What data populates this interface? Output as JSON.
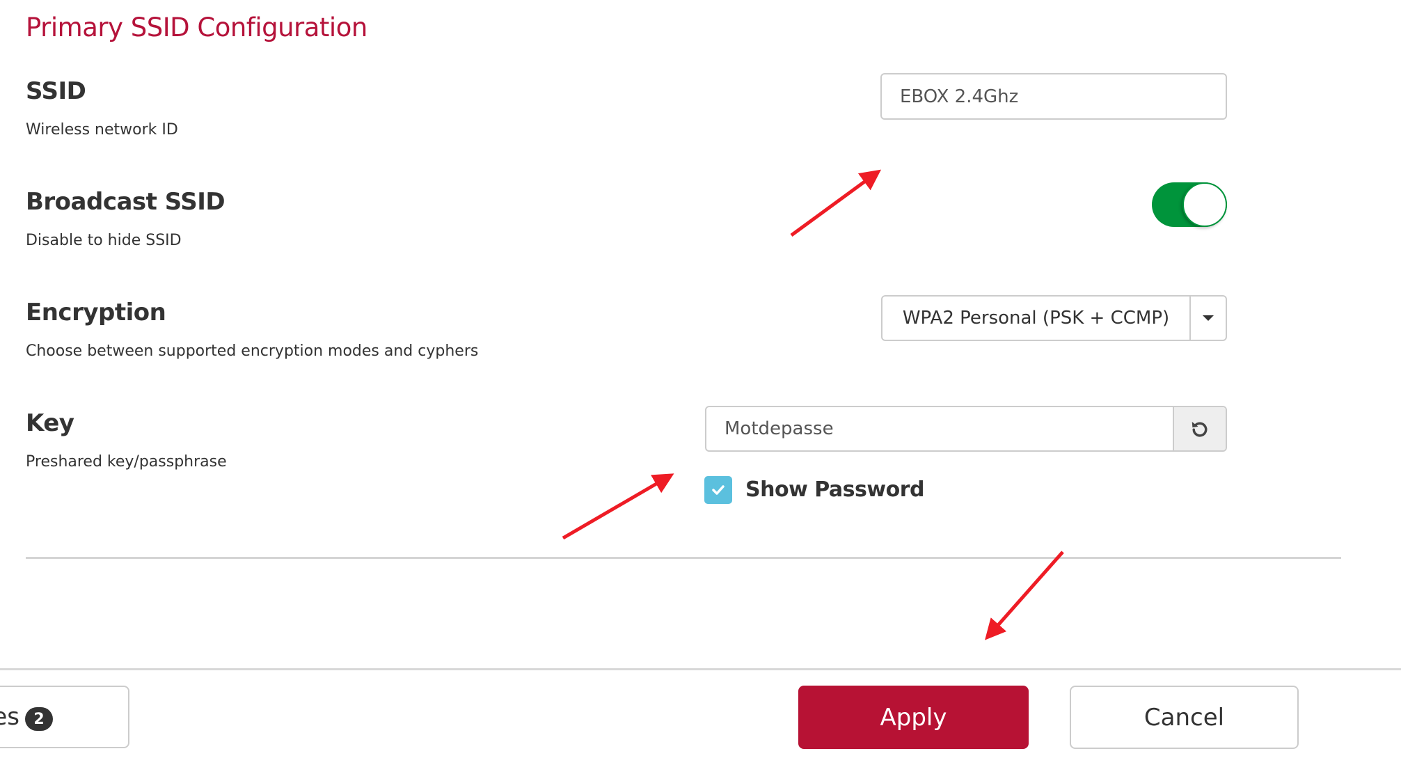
{
  "section": {
    "title": "Primary SSID Configuration"
  },
  "ssid": {
    "label": "SSID",
    "description": "Wireless network ID",
    "value": "EBOX 2.4Ghz"
  },
  "broadcast": {
    "label": "Broadcast SSID",
    "description": "Disable to hide SSID",
    "enabled": true,
    "on_color": "#00943b"
  },
  "encryption": {
    "label": "Encryption",
    "description": "Choose between supported encryption modes and cyphers",
    "selected": "WPA2 Personal (PSK + CCMP)"
  },
  "key": {
    "label": "Key",
    "description": "Preshared key/passphrase",
    "value": "Motdepasse",
    "regenerate_icon": "refresh-icon",
    "show_password_label": "Show Password",
    "show_password_checked": true
  },
  "footer": {
    "changes_label_partial": "es",
    "changes_count": "2",
    "apply_label": "Apply",
    "cancel_label": "Cancel",
    "apply_color": "#b71234"
  },
  "annotations": {
    "arrow_color": "#ee1c25",
    "arrow_icon": "red-arrow-annotation"
  },
  "colors": {
    "title": "#b5123a",
    "checkbox": "#5bc0de"
  }
}
